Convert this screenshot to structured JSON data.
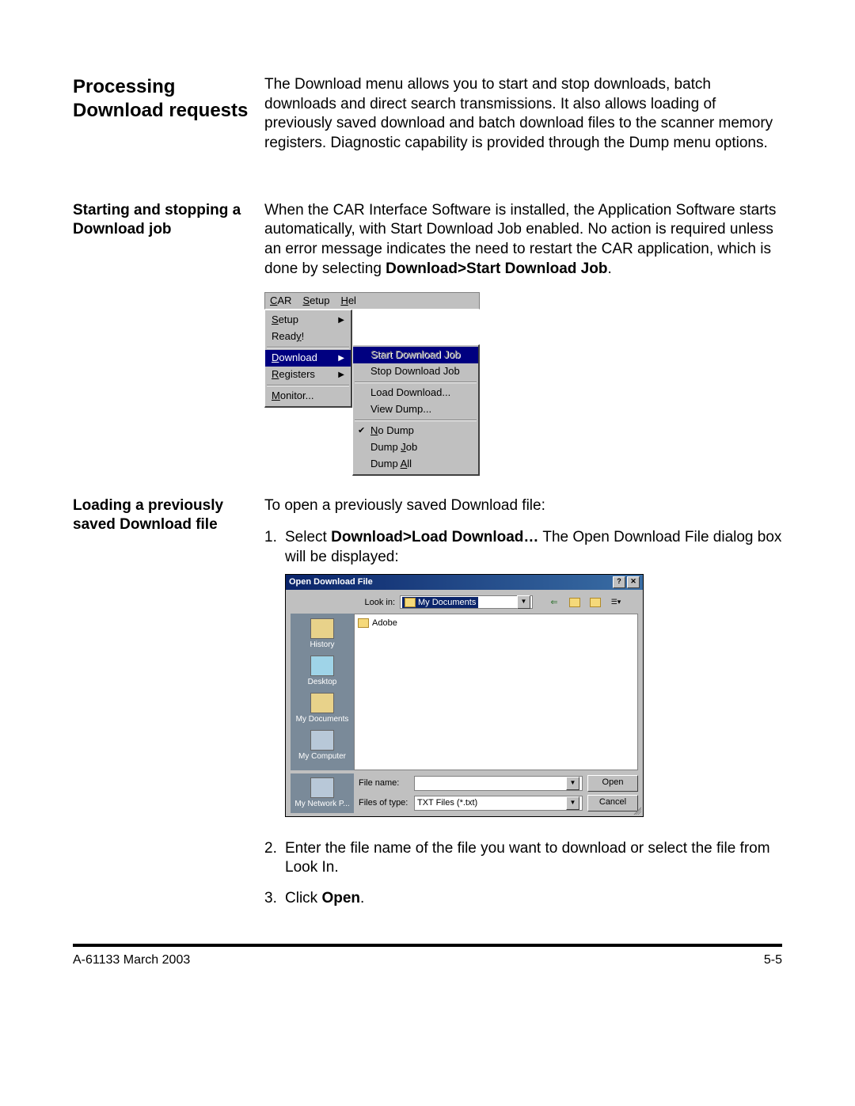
{
  "section1": {
    "heading": "Processing Download requests",
    "body": "The Download menu allows you to start and stop downloads, batch downloads and direct search transmissions. It also allows loading of previously saved download and batch download files to the scanner memory registers. Diagnostic capability is provided through the Dump menu options."
  },
  "section2": {
    "heading": "Starting and stopping a Download job",
    "body_pre": "When the CAR Interface Software is installed, the Application Software starts automatically, with Start Download Job enabled.  No action is required unless an error message indicates the need to restart the CAR application, which is done by selecting ",
    "body_bold": "Download>Start Download Job",
    "body_post": "."
  },
  "menu": {
    "bar": [
      "CAR",
      "Setup",
      "Hel"
    ],
    "items": [
      {
        "label": "Setup",
        "arrow": true
      },
      {
        "label": "Ready!"
      },
      {
        "label": "Download",
        "arrow": true,
        "highlight": true
      },
      {
        "label": "Registers",
        "arrow": true
      },
      {
        "label": "Monitor..."
      }
    ],
    "submenu": {
      "groups": [
        [
          {
            "label": "Start Download Job",
            "highlight": true,
            "dimmed": true
          },
          {
            "label": "Stop Download Job"
          }
        ],
        [
          {
            "label": "Load Download..."
          },
          {
            "label": "View Dump..."
          }
        ],
        [
          {
            "label": "No Dump",
            "checked": true
          },
          {
            "label": "Dump Job"
          },
          {
            "label": "Dump All"
          }
        ]
      ]
    }
  },
  "section3": {
    "heading": "Loading a previously saved Download file",
    "intro": "To open a previously saved Download file:",
    "steps": [
      {
        "num": "1.",
        "pre": "Select ",
        "bold": "Download>Load Download…",
        "mid": "  The Open Download File dialog box will be displayed:"
      },
      {
        "num": "2.",
        "text": "Enter the file name of the file you want to download or select the file from Look In."
      },
      {
        "num": "3.",
        "pre": "Click ",
        "bold": "Open",
        "post": "."
      }
    ]
  },
  "dialog": {
    "title": "Open Download File",
    "lookin_label": "Look in:",
    "lookin_value": "My Documents",
    "places": [
      "History",
      "Desktop",
      "My Documents",
      "My Computer",
      "My Network P..."
    ],
    "file_list": [
      "Adobe"
    ],
    "filename_label": "File name:",
    "filename_value": "",
    "filetype_label": "Files of type:",
    "filetype_value": "TXT Files  (*.txt)",
    "open_btn": "Open",
    "cancel_btn": "Cancel"
  },
  "footer": {
    "left": "A-61133  March 2003",
    "right": "5-5"
  }
}
